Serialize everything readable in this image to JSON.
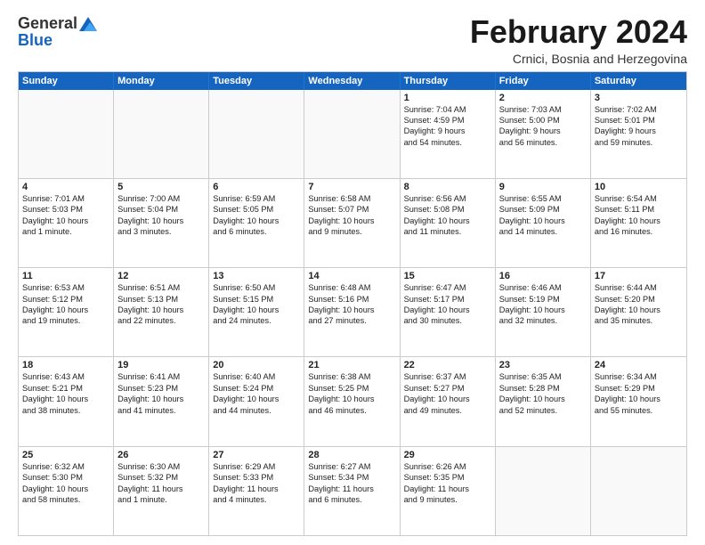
{
  "header": {
    "logo_general": "General",
    "logo_blue": "Blue",
    "month_title": "February 2024",
    "location": "Crnici, Bosnia and Herzegovina"
  },
  "weekdays": [
    "Sunday",
    "Monday",
    "Tuesday",
    "Wednesday",
    "Thursday",
    "Friday",
    "Saturday"
  ],
  "rows": [
    [
      {
        "day": "",
        "lines": []
      },
      {
        "day": "",
        "lines": []
      },
      {
        "day": "",
        "lines": []
      },
      {
        "day": "",
        "lines": []
      },
      {
        "day": "1",
        "lines": [
          "Sunrise: 7:04 AM",
          "Sunset: 4:59 PM",
          "Daylight: 9 hours",
          "and 54 minutes."
        ]
      },
      {
        "day": "2",
        "lines": [
          "Sunrise: 7:03 AM",
          "Sunset: 5:00 PM",
          "Daylight: 9 hours",
          "and 56 minutes."
        ]
      },
      {
        "day": "3",
        "lines": [
          "Sunrise: 7:02 AM",
          "Sunset: 5:01 PM",
          "Daylight: 9 hours",
          "and 59 minutes."
        ]
      }
    ],
    [
      {
        "day": "4",
        "lines": [
          "Sunrise: 7:01 AM",
          "Sunset: 5:03 PM",
          "Daylight: 10 hours",
          "and 1 minute."
        ]
      },
      {
        "day": "5",
        "lines": [
          "Sunrise: 7:00 AM",
          "Sunset: 5:04 PM",
          "Daylight: 10 hours",
          "and 3 minutes."
        ]
      },
      {
        "day": "6",
        "lines": [
          "Sunrise: 6:59 AM",
          "Sunset: 5:05 PM",
          "Daylight: 10 hours",
          "and 6 minutes."
        ]
      },
      {
        "day": "7",
        "lines": [
          "Sunrise: 6:58 AM",
          "Sunset: 5:07 PM",
          "Daylight: 10 hours",
          "and 9 minutes."
        ]
      },
      {
        "day": "8",
        "lines": [
          "Sunrise: 6:56 AM",
          "Sunset: 5:08 PM",
          "Daylight: 10 hours",
          "and 11 minutes."
        ]
      },
      {
        "day": "9",
        "lines": [
          "Sunrise: 6:55 AM",
          "Sunset: 5:09 PM",
          "Daylight: 10 hours",
          "and 14 minutes."
        ]
      },
      {
        "day": "10",
        "lines": [
          "Sunrise: 6:54 AM",
          "Sunset: 5:11 PM",
          "Daylight: 10 hours",
          "and 16 minutes."
        ]
      }
    ],
    [
      {
        "day": "11",
        "lines": [
          "Sunrise: 6:53 AM",
          "Sunset: 5:12 PM",
          "Daylight: 10 hours",
          "and 19 minutes."
        ]
      },
      {
        "day": "12",
        "lines": [
          "Sunrise: 6:51 AM",
          "Sunset: 5:13 PM",
          "Daylight: 10 hours",
          "and 22 minutes."
        ]
      },
      {
        "day": "13",
        "lines": [
          "Sunrise: 6:50 AM",
          "Sunset: 5:15 PM",
          "Daylight: 10 hours",
          "and 24 minutes."
        ]
      },
      {
        "day": "14",
        "lines": [
          "Sunrise: 6:48 AM",
          "Sunset: 5:16 PM",
          "Daylight: 10 hours",
          "and 27 minutes."
        ]
      },
      {
        "day": "15",
        "lines": [
          "Sunrise: 6:47 AM",
          "Sunset: 5:17 PM",
          "Daylight: 10 hours",
          "and 30 minutes."
        ]
      },
      {
        "day": "16",
        "lines": [
          "Sunrise: 6:46 AM",
          "Sunset: 5:19 PM",
          "Daylight: 10 hours",
          "and 32 minutes."
        ]
      },
      {
        "day": "17",
        "lines": [
          "Sunrise: 6:44 AM",
          "Sunset: 5:20 PM",
          "Daylight: 10 hours",
          "and 35 minutes."
        ]
      }
    ],
    [
      {
        "day": "18",
        "lines": [
          "Sunrise: 6:43 AM",
          "Sunset: 5:21 PM",
          "Daylight: 10 hours",
          "and 38 minutes."
        ]
      },
      {
        "day": "19",
        "lines": [
          "Sunrise: 6:41 AM",
          "Sunset: 5:23 PM",
          "Daylight: 10 hours",
          "and 41 minutes."
        ]
      },
      {
        "day": "20",
        "lines": [
          "Sunrise: 6:40 AM",
          "Sunset: 5:24 PM",
          "Daylight: 10 hours",
          "and 44 minutes."
        ]
      },
      {
        "day": "21",
        "lines": [
          "Sunrise: 6:38 AM",
          "Sunset: 5:25 PM",
          "Daylight: 10 hours",
          "and 46 minutes."
        ]
      },
      {
        "day": "22",
        "lines": [
          "Sunrise: 6:37 AM",
          "Sunset: 5:27 PM",
          "Daylight: 10 hours",
          "and 49 minutes."
        ]
      },
      {
        "day": "23",
        "lines": [
          "Sunrise: 6:35 AM",
          "Sunset: 5:28 PM",
          "Daylight: 10 hours",
          "and 52 minutes."
        ]
      },
      {
        "day": "24",
        "lines": [
          "Sunrise: 6:34 AM",
          "Sunset: 5:29 PM",
          "Daylight: 10 hours",
          "and 55 minutes."
        ]
      }
    ],
    [
      {
        "day": "25",
        "lines": [
          "Sunrise: 6:32 AM",
          "Sunset: 5:30 PM",
          "Daylight: 10 hours",
          "and 58 minutes."
        ]
      },
      {
        "day": "26",
        "lines": [
          "Sunrise: 6:30 AM",
          "Sunset: 5:32 PM",
          "Daylight: 11 hours",
          "and 1 minute."
        ]
      },
      {
        "day": "27",
        "lines": [
          "Sunrise: 6:29 AM",
          "Sunset: 5:33 PM",
          "Daylight: 11 hours",
          "and 4 minutes."
        ]
      },
      {
        "day": "28",
        "lines": [
          "Sunrise: 6:27 AM",
          "Sunset: 5:34 PM",
          "Daylight: 11 hours",
          "and 6 minutes."
        ]
      },
      {
        "day": "29",
        "lines": [
          "Sunrise: 6:26 AM",
          "Sunset: 5:35 PM",
          "Daylight: 11 hours",
          "and 9 minutes."
        ]
      },
      {
        "day": "",
        "lines": []
      },
      {
        "day": "",
        "lines": []
      }
    ]
  ]
}
